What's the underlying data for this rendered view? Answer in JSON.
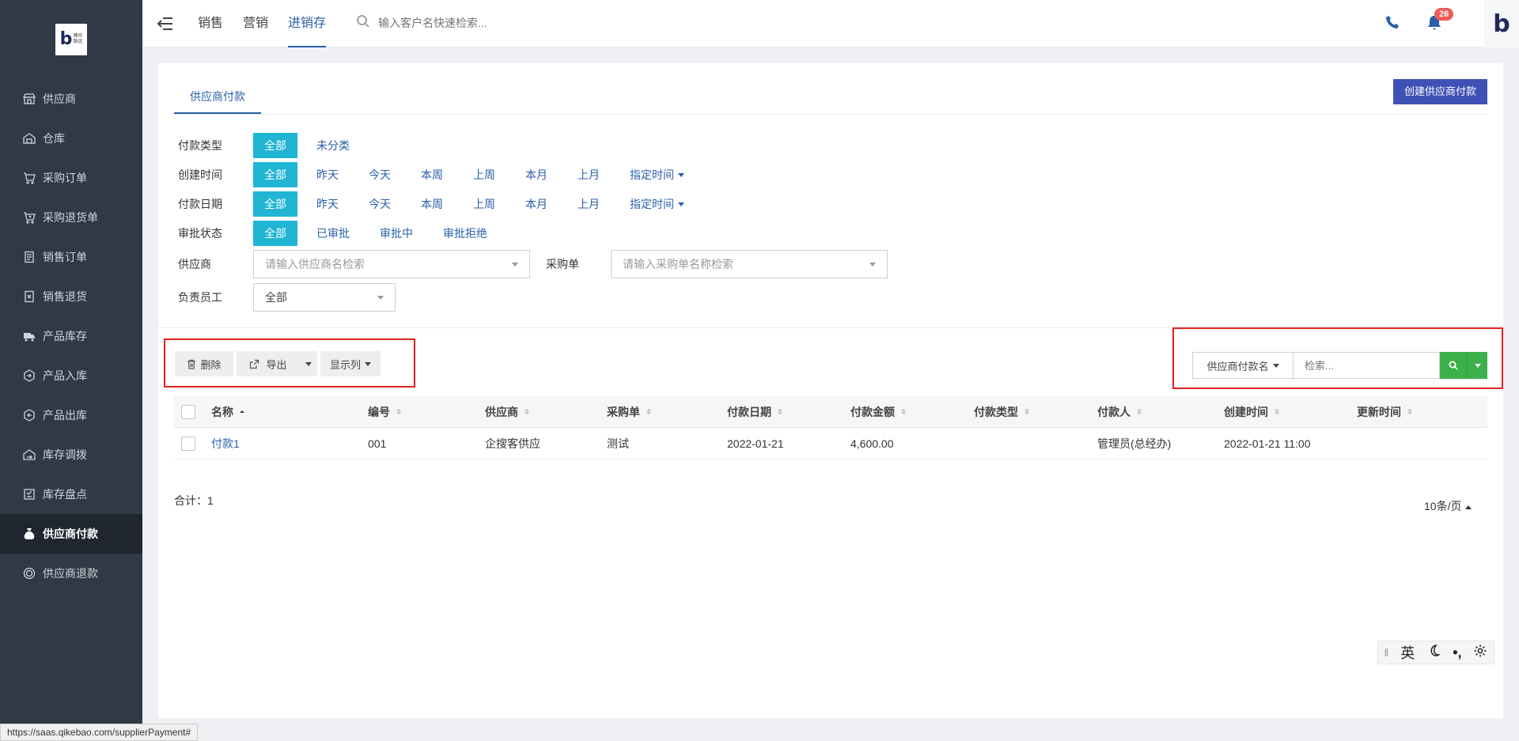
{
  "brand": {
    "logo_letter": "b",
    "logo_sub": "博众\n致远"
  },
  "sidebar": {
    "items": [
      {
        "label": "供应商",
        "icon": "store-icon"
      },
      {
        "label": "仓库",
        "icon": "warehouse-icon"
      },
      {
        "label": "采购订单",
        "icon": "cart-icon"
      },
      {
        "label": "采购退货单",
        "icon": "cart-return-icon"
      },
      {
        "label": "销售订单",
        "icon": "doc-list-icon"
      },
      {
        "label": "销售退货",
        "icon": "doc-return-icon"
      },
      {
        "label": "产品库存",
        "icon": "truck-icon"
      },
      {
        "label": "产品入库",
        "icon": "box-in-icon"
      },
      {
        "label": "产品出库",
        "icon": "box-out-icon"
      },
      {
        "label": "库存调拨",
        "icon": "transfer-icon"
      },
      {
        "label": "库存盘点",
        "icon": "inventory-icon"
      },
      {
        "label": "供应商付款",
        "icon": "money-bag-icon",
        "active": true
      },
      {
        "label": "供应商退款",
        "icon": "refund-icon"
      }
    ]
  },
  "status_url": "https://saas.qikebao.com/supplierPayment#",
  "topbar": {
    "nav": [
      "销售",
      "营销",
      "进销存"
    ],
    "active_nav": 2,
    "search_placeholder": "输入客户名快速检索...",
    "notification_count": "26",
    "avatar_letter": "b"
  },
  "page": {
    "tab": "供应商付款",
    "create_button": "创建供应商付款"
  },
  "filters": {
    "payment_type": {
      "label": "付款类型",
      "options": [
        "全部",
        "未分类"
      ]
    },
    "created_time": {
      "label": "创建时间",
      "options": [
        "全部",
        "昨天",
        "今天",
        "本周",
        "上周",
        "本月",
        "上月"
      ],
      "custom": "指定时间"
    },
    "payment_date": {
      "label": "付款日期",
      "options": [
        "全部",
        "昨天",
        "今天",
        "本周",
        "上周",
        "本月",
        "上月"
      ],
      "custom": "指定时间"
    },
    "approval": {
      "label": "审批状态",
      "options": [
        "全部",
        "已审批",
        "审批中",
        "审批拒绝"
      ]
    },
    "supplier": {
      "label": "供应商",
      "placeholder": "请输入供应商名检索"
    },
    "purchase_order": {
      "label": "采购单",
      "placeholder": "请输入采购单名称检索"
    },
    "employee": {
      "label": "负责员工",
      "value": "全部"
    }
  },
  "toolbar": {
    "delete": "删除",
    "export": "导出",
    "columns": "显示列",
    "search_field": "供应商付款名",
    "search_placeholder": "检索..."
  },
  "table": {
    "columns": [
      "名称",
      "编号",
      "供应商",
      "采购单",
      "付款日期",
      "付款金额",
      "付款类型",
      "付款人",
      "创建时间",
      "更新时间"
    ],
    "rows": [
      {
        "name": "付款1",
        "code": "001",
        "supplier": "企搜客供应",
        "po": "测试",
        "pay_date": "2022-01-21",
        "amount": "4,600.00",
        "type": "",
        "payer": "管理员(总经办)",
        "created": "2022-01-21 11:00",
        "updated": ""
      }
    ]
  },
  "footer": {
    "total": "合计：1",
    "page_size": "10条/页"
  },
  "ime": {
    "lang": "英"
  },
  "colors": {
    "sidebar": "#2f3a46",
    "accent": "#2a5fa8",
    "chip": "#1fb5d3",
    "create": "#3f51b5",
    "search": "#3cb04a",
    "highlight": "#e02020"
  }
}
